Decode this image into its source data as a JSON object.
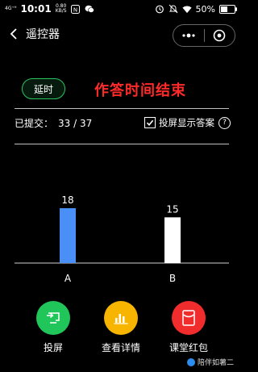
{
  "status_bar": {
    "signal": "4G⁺ᴴ",
    "time": "10:01",
    "net_speed": "0.80",
    "net_unit": "KB/S",
    "nfc": "N",
    "battery": "50%",
    "battery_level": 0.5
  },
  "nav": {
    "title": "遥控器"
  },
  "controls": {
    "delay_label": "延时",
    "end_text": "作答时间结束"
  },
  "submit": {
    "label": "已提交：",
    "count": "33 / 37"
  },
  "projection": {
    "label": "投屏显示答案",
    "checked": true,
    "help": "?"
  },
  "chart_data": {
    "type": "bar",
    "categories": [
      "A",
      "B"
    ],
    "values": [
      18,
      15
    ],
    "colors": [
      "#4a8ff5",
      "#ffffff"
    ],
    "ylim": [
      0,
      18
    ]
  },
  "actions": [
    {
      "label": "投屏",
      "color": "#21c65a",
      "icon": "projection-icon"
    },
    {
      "label": "查看详情",
      "color": "#f7b500",
      "icon": "bar-chart-icon"
    },
    {
      "label": "课堂红包",
      "color": "#f02c2c",
      "icon": "red-envelope-icon"
    }
  ],
  "watermark": "陪伴如薯二"
}
